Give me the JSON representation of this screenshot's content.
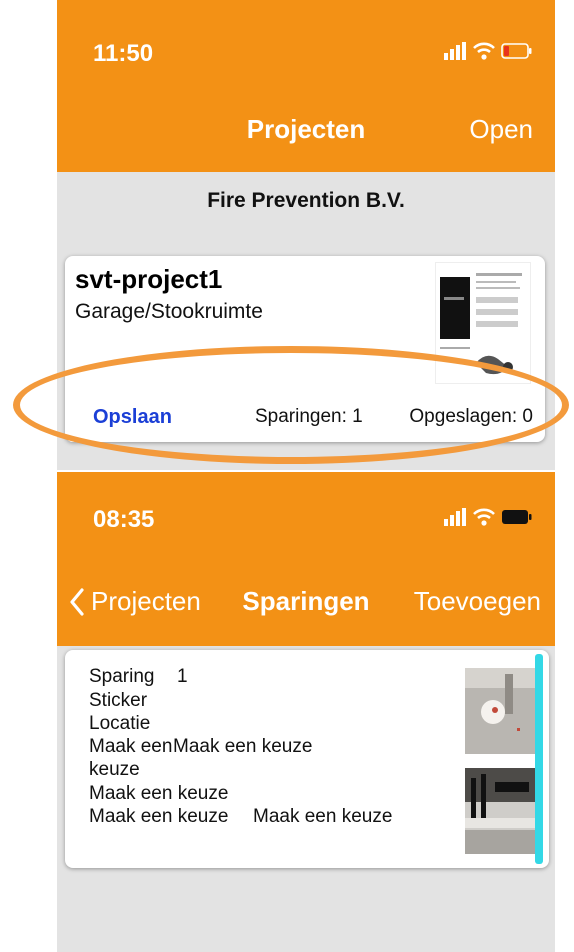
{
  "screen1": {
    "status": {
      "time": "11:50"
    },
    "nav": {
      "title": "Projecten",
      "right_button": "Open"
    },
    "company": "Fire Prevention B.V.",
    "project_card": {
      "name": "svt-project1",
      "location": "Garage/Stookruimte",
      "save_label": "Opslaan",
      "sparingen_label": "Sparingen: 1",
      "opgeslagen_label": "Opgeslagen: 0"
    }
  },
  "screen2": {
    "status": {
      "time": "08:35"
    },
    "nav": {
      "back_label": "Projecten",
      "title": "Sparingen",
      "right_button": "Toevoegen"
    },
    "sparing_card": {
      "sparing_label": "Sparing",
      "sparing_number": "1",
      "sticker_label": "Sticker",
      "locatie_label": "Locatie",
      "choice1a": "Maak een",
      "choice1b": "Maak een keuze",
      "choice1c": "keuze",
      "choice2": "Maak een keuze",
      "choice3a": "Maak een keuze",
      "choice3b": "Maak een keuze"
    }
  },
  "colors": {
    "header": "#f39115",
    "accent": "#33d8e6",
    "link": "#1b3fd6",
    "highlight": "#f39a3c"
  },
  "icons": [
    "signal-icon",
    "wifi-icon",
    "battery-low-icon",
    "battery-full-icon",
    "chevron-left-icon"
  ]
}
